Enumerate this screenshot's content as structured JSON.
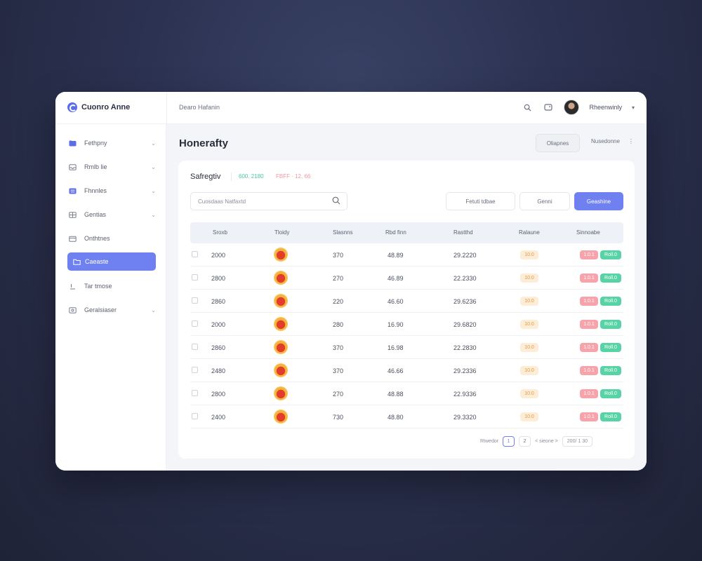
{
  "app": {
    "name": "Cuonro Anne",
    "breadcrumb": "Dearo Hafanin"
  },
  "topbar": {
    "user_name": "Rheenwinly",
    "caret": "▾",
    "search_icon": "search-icon",
    "message_icon": "message-icon"
  },
  "sidebar": {
    "items": [
      {
        "label": "Fethpny",
        "icon": "folder-icon",
        "chevron": true
      },
      {
        "label": "Rmlb lie",
        "icon": "inbox-icon",
        "chevron": true
      },
      {
        "label": "Fhnnles",
        "icon": "list-icon",
        "chevron": true
      },
      {
        "label": "Gentias",
        "icon": "grid-icon",
        "chevron": true
      },
      {
        "label": "Onthtnes",
        "icon": "calendar-icon",
        "chevron": false
      },
      {
        "label": "Caeaste",
        "icon": "folder-open-icon",
        "chevron": false,
        "active": true
      },
      {
        "label": "Tar tmose",
        "icon": "user-icon",
        "chevron": false
      },
      {
        "label": "Geralsiaser",
        "icon": "settings-icon",
        "chevron": true
      }
    ]
  },
  "header": {
    "title": "Honerafty",
    "button_label": "Oliapnes",
    "select_label": "Nusedonne",
    "select_icon": "sort-icon"
  },
  "card": {
    "title": "Safregtiv",
    "chip_green": "600. 2180",
    "chip_red": "FBFF · 12. 66"
  },
  "toolbar": {
    "search_placeholder": "Cuosdaas Natfaxtd",
    "filter1": "Fetuti tdbae",
    "filter2": "Genni",
    "primary": "Geashine"
  },
  "table": {
    "columns": [
      "Sroxb",
      "Tloidy",
      "Slasnns",
      "Rbd finn",
      "Rastthd",
      "Ralaune",
      "Sinnoabe"
    ],
    "rows": [
      {
        "id": "2000",
        "qty": "370",
        "price": "48.89",
        "total": "29.2220",
        "badge": "10.0",
        "tag1": "1.0.1",
        "tag2": "Roll.0"
      },
      {
        "id": "2800",
        "qty": "270",
        "price": "46.89",
        "total": "22.2330",
        "badge": "10.0",
        "tag1": "1.0.1",
        "tag2": "Roll.0"
      },
      {
        "id": "2860",
        "qty": "220",
        "price": "46.60",
        "total": "29.6236",
        "badge": "10.0",
        "tag1": "1.0.1",
        "tag2": "Roll.0"
      },
      {
        "id": "2000",
        "qty": "280",
        "price": "16.90",
        "total": "29.6820",
        "badge": "10.0",
        "tag1": "1.0.1",
        "tag2": "Roll.0"
      },
      {
        "id": "2860",
        "qty": "370",
        "price": "16.98",
        "total": "22.2830",
        "badge": "10.0",
        "tag1": "1.0.1",
        "tag2": "Roll.0"
      },
      {
        "id": "2480",
        "qty": "370",
        "price": "46.66",
        "total": "29.2336",
        "badge": "10.0",
        "tag1": "1.0.1",
        "tag2": "Roll.0"
      },
      {
        "id": "2800",
        "qty": "270",
        "price": "48.88",
        "total": "22.9336",
        "badge": "10.0",
        "tag1": "1.0.1",
        "tag2": "Roll.0"
      },
      {
        "id": "2400",
        "qty": "730",
        "price": "48.80",
        "total": "29.3320",
        "badge": "10.0",
        "tag1": "1.0.1",
        "tag2": "Roll.0"
      }
    ]
  },
  "pagination": {
    "label": "Rtwedor",
    "page1": "1",
    "page2": "2",
    "nav": "< sieone >",
    "per_page": "200/ 1 30"
  },
  "colors": {
    "accent": "#6f80f0",
    "green": "#57d3a6",
    "red": "#f6a3ab",
    "orange": "#e49a46"
  }
}
